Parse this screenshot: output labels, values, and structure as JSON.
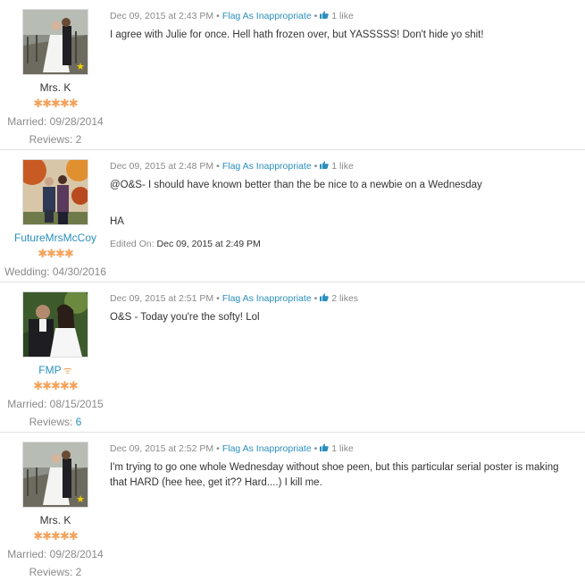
{
  "posts": [
    {
      "author": {
        "name": "Mrs. K",
        "stars": "✱✱✱✱✱",
        "date_label": "Married: 09/28/2014",
        "reviews_label": "Reviews:",
        "reviews_count": "2"
      },
      "timestamp": "Dec 09, 2015 at 2:43 PM",
      "flag_label": "Flag As Inappropriate",
      "likes": "1 like",
      "text": "I agree with Julie for once. Hell hath frozen over, but YASSSSS! Don't hide yo shit!"
    },
    {
      "author": {
        "name": "FutureMrsMcCoy",
        "stars": "✱✱✱✱",
        "date_label": "Wedding: 04/30/2016"
      },
      "timestamp": "Dec 09, 2015 at 2:48 PM",
      "flag_label": "Flag As Inappropriate",
      "likes": "1 like",
      "text": "@O&S- I should have known better than the be nice to a newbie on a Wednesday",
      "text2": "HA",
      "edited_label": "Edited On:",
      "edited_value": "Dec 09, 2015 at 2:49 PM"
    },
    {
      "author": {
        "name": "FMP",
        "stars": "✱✱✱✱✱",
        "date_label": "Married: 08/15/2015",
        "reviews_label": "Reviews:",
        "reviews_count": "6"
      },
      "timestamp": "Dec 09, 2015 at 2:51 PM",
      "flag_label": "Flag As Inappropriate",
      "likes": "2 likes",
      "text": "O&S - Today you're the softy! Lol"
    },
    {
      "author": {
        "name": "Mrs. K",
        "stars": "✱✱✱✱✱",
        "date_label": "Married: 09/28/2014",
        "reviews_label": "Reviews:",
        "reviews_count": "2"
      },
      "timestamp": "Dec 09, 2015 at 2:52 PM",
      "flag_label": "Flag As Inappropriate",
      "likes": "1 like",
      "text": "I'm trying to go one whole Wednesday without shoe peen, but this particular serial poster is making that HARD (hee hee, get it?? Hard....) I kill me."
    }
  ],
  "icons": {
    "like": "thumbs-up-icon",
    "badge": "star-badge-icon",
    "signal": "signal-icon"
  },
  "colors": {
    "link": "#2a8fbd",
    "stars": "#f4a25b",
    "muted": "#8a8a8a"
  }
}
